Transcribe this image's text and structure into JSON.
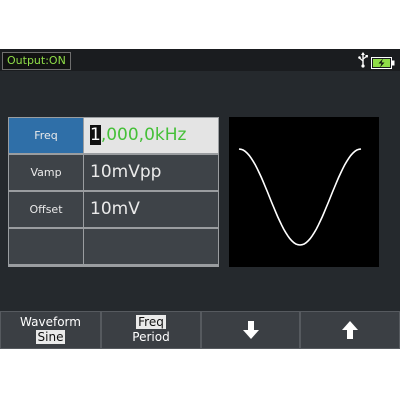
{
  "status": {
    "output_label": "Output:ON",
    "usb_icon": "usb-icon",
    "battery_icon": "battery-charging-icon"
  },
  "params": [
    {
      "label": "Freq",
      "value_prefix": "1",
      "value_rest": ",000,0kHz",
      "selected": true
    },
    {
      "label": "Vamp",
      "value": "10mVpp",
      "selected": false
    },
    {
      "label": "Offset",
      "value": "10mV",
      "selected": false
    },
    {
      "label": "",
      "value": "",
      "selected": false
    }
  ],
  "waveform_preview": {
    "shape": "sine",
    "color": "#ffffff"
  },
  "softkeys": {
    "waveform": {
      "top": "Waveform",
      "bottom": "Sine"
    },
    "freq": {
      "top": "Freq",
      "bottom": "Period"
    },
    "down_icon": "arrow-down-icon",
    "up_icon": "arrow-up-icon"
  },
  "colors": {
    "output_text": "#8fdd48",
    "selected_value_text": "#45c038",
    "selected_label_bg": "#2f6fa8",
    "screen_bg": "#25292d"
  }
}
